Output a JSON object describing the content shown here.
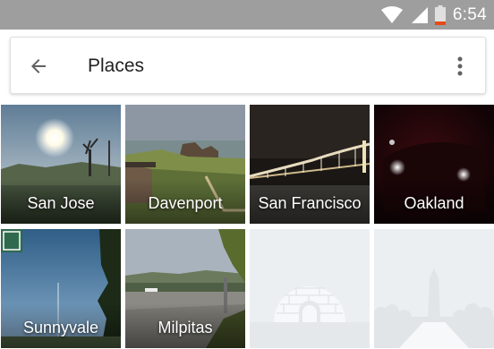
{
  "status_bar": {
    "time": "6:54",
    "icons": [
      "wifi-icon",
      "signal-icon",
      "battery-low-icon"
    ]
  },
  "header": {
    "title": "Places",
    "back_icon": "arrow-back-icon",
    "menu_icon": "more-vert-icon"
  },
  "places": [
    {
      "label": "San Jose"
    },
    {
      "label": "Davenport"
    },
    {
      "label": "San Francisco"
    },
    {
      "label": "Oakland"
    },
    {
      "label": "Sunnyvale"
    },
    {
      "label": "Milpitas"
    },
    {
      "label": ""
    },
    {
      "label": ""
    }
  ],
  "colors": {
    "status_bar": "#9e9e9e",
    "placeholder_tile": "#eceff1",
    "placeholder_icon": "#f5f6f7"
  }
}
